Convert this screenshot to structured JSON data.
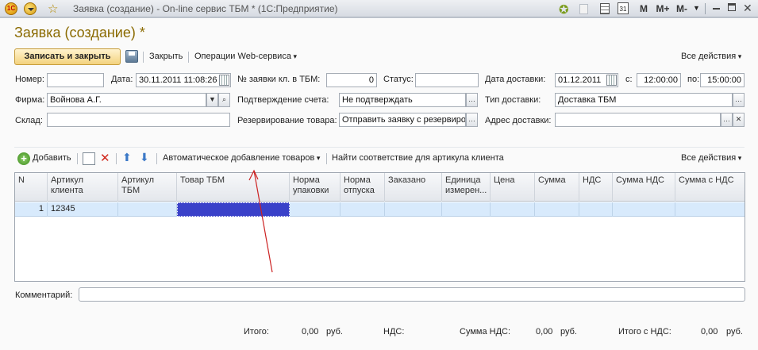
{
  "window": {
    "title": "Заявка (создание) - On-line сервис ТБМ * (1С:Предприятие)",
    "logo_text": "1С",
    "buttons": [
      "M",
      "M+",
      "M-"
    ],
    "icons": [
      "star-icon",
      "copy-icon",
      "calculator-icon",
      "calendar-icon"
    ]
  },
  "form": {
    "title": "Заявка (создание) *",
    "toolbar": {
      "save_close": "Записать и закрыть",
      "close": "Закрыть",
      "web_ops": "Операции Web-сервиса",
      "all_actions": "Все действия"
    },
    "fields": {
      "number_label": "Номер:",
      "number_value": "",
      "date_label": "Дата:",
      "date_value": "30.11.2011 11:08:26",
      "client_no_label": "№ заявки кл. в ТБМ:",
      "client_no_value": "0",
      "status_label": "Статус:",
      "status_value": "",
      "delivery_date_label": "Дата доставки:",
      "delivery_date_value": "01.12.2011",
      "from_label": "с:",
      "from_value": "12:00:00",
      "to_label": "по:",
      "to_value": "15:00:00",
      "firm_label": "Фирма:",
      "firm_value": "Войнова А.Г.",
      "confirm_label": "Подтверждение счета:",
      "confirm_value": "Не подтверждать",
      "delivery_type_label": "Тип доставки:",
      "delivery_type_value": "Доставка ТБМ",
      "warehouse_label": "Склад:",
      "warehouse_value": "",
      "reserve_label": "Резервирование товара:",
      "reserve_value": "Отправить заявку с резервиро",
      "address_label": "Адрес доставки:",
      "address_value": ""
    },
    "table_toolbar": {
      "add": "Добавить",
      "auto_add": "Автоматическое добавление товаров",
      "find_match": "Найти соответствие для артикула клиента",
      "all_actions": "Все действия"
    },
    "table": {
      "columns": [
        "N",
        "Артикул клиента",
        "Артикул ТБМ",
        "Товар ТБМ",
        "Норма упаковки",
        "Норма отпуска",
        "Заказано",
        "Единица измерен...",
        "Цена",
        "Сумма",
        "НДС",
        "Сумма НДС",
        "Сумма с НДС"
      ],
      "rows": [
        [
          "1",
          "12345",
          "",
          "",
          "",
          "",
          "",
          "",
          "",
          "",
          "",
          "",
          ""
        ]
      ]
    },
    "comment_label": "Комментарий:",
    "comment_value": "",
    "totals": {
      "total_label": "Итого:",
      "total_value": "0,00",
      "total_unit": "руб.",
      "vat_label": "НДС:",
      "vat_sum_label": "Сумма НДС:",
      "vat_sum_value": "0,00",
      "vat_sum_unit": "руб.",
      "total_vat_label": "Итого с НДС:",
      "total_vat_value": "0,00",
      "total_vat_unit": "руб."
    }
  },
  "colors": {
    "title": "#8a6a00",
    "row_selected": "#d8eafc",
    "cell_active": "#3a41c9",
    "annotation_arrow": "#cc2222"
  }
}
